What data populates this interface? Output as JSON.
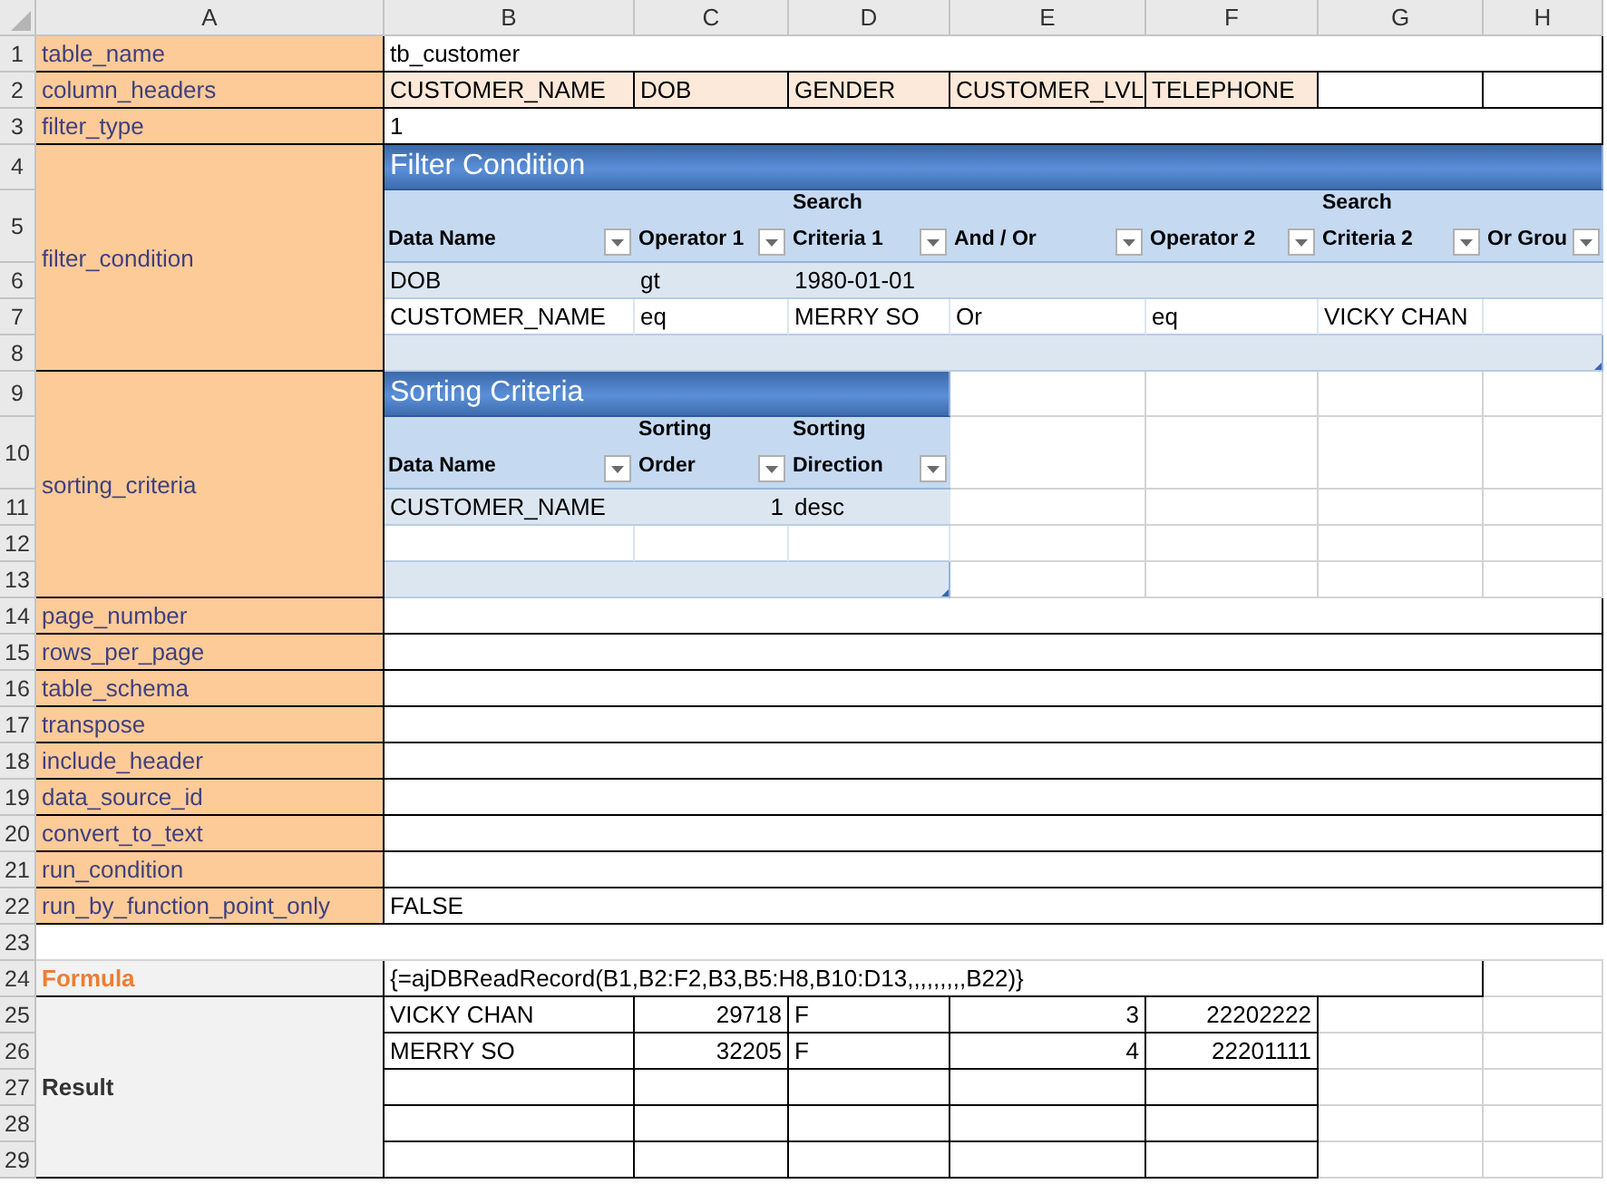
{
  "column_headers": [
    "A",
    "B",
    "C",
    "D",
    "E",
    "F",
    "G",
    "H"
  ],
  "row_headers": [
    "1",
    "2",
    "3",
    "4",
    "5",
    "6",
    "7",
    "8",
    "9",
    "10",
    "11",
    "12",
    "13",
    "14",
    "15",
    "16",
    "17",
    "18",
    "19",
    "20",
    "21",
    "22",
    "23",
    "24",
    "25",
    "26",
    "27",
    "28",
    "29"
  ],
  "table_name": {
    "label": "table_name",
    "value": "tb_customer"
  },
  "column_headers_param": {
    "label": "column_headers",
    "values": [
      "CUSTOMER_NAME",
      "DOB",
      "GENDER",
      "CUSTOMER_LVL",
      "TELEPHONE"
    ]
  },
  "filter_type": {
    "label": "filter_type",
    "value": "1"
  },
  "filter_condition": {
    "label": "filter_condition",
    "title": "Filter Condition",
    "columns": [
      "Data Name",
      "Operator 1",
      "Search Criteria 1",
      "And / Or",
      "Operator 2",
      "Search Criteria 2",
      "Or Grou"
    ],
    "rows": [
      [
        "DOB",
        "gt",
        "1980-01-01"
      ],
      [
        "CUSTOMER_NAME",
        "eq",
        "MERRY SO",
        "Or",
        "eq",
        "VICKY CHAN"
      ]
    ]
  },
  "sorting_criteria": {
    "label": "sorting_criteria",
    "title": "Sorting Criteria",
    "columns": [
      "Data Name",
      "Sorting Order",
      "Sorting Direction"
    ],
    "rows": [
      [
        "CUSTOMER_NAME",
        "1",
        "desc"
      ]
    ]
  },
  "parameters": [
    {
      "name": "page_number"
    },
    {
      "name": "rows_per_page"
    },
    {
      "name": "table_schema"
    },
    {
      "name": "transpose"
    },
    {
      "name": "include_header"
    },
    {
      "name": "data_source_id"
    },
    {
      "name": "convert_to_text"
    },
    {
      "name": "run_condition"
    },
    {
      "name": "run_by_function_point_only",
      "value": "FALSE"
    }
  ],
  "formula": {
    "label": "Formula",
    "value": "{=ajDBReadRecord(B1,B2:F2,B3,B5:H8,B10:D13,,,,,,,,,B22)}"
  },
  "result": {
    "label": "Result",
    "rows": [
      [
        "VICKY CHAN",
        "29718",
        "F",
        "3",
        "22202222"
      ],
      [
        "MERRY SO",
        "32205",
        "F",
        "4",
        "22201111"
      ]
    ]
  }
}
